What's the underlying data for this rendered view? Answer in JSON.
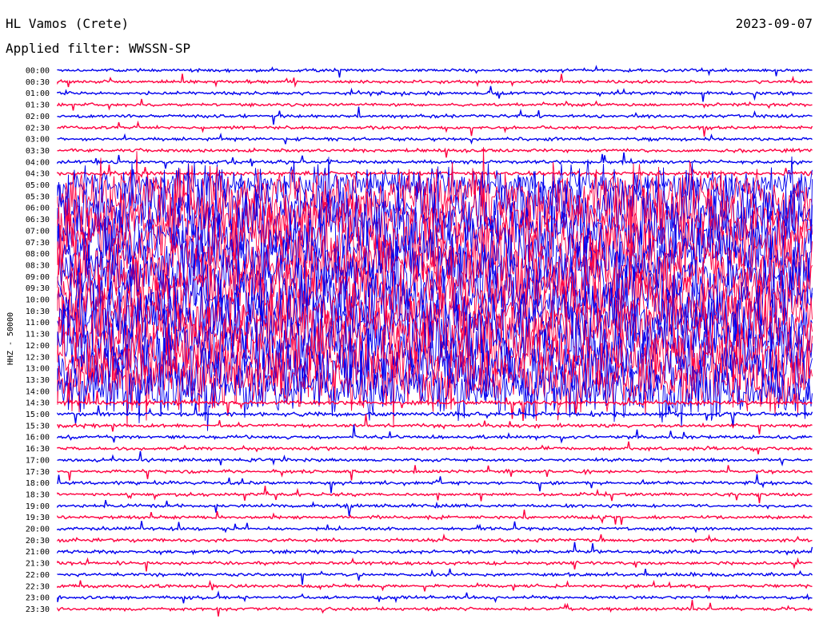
{
  "header": {
    "station": "HL Vamos (Crete)",
    "date": "2023-09-07",
    "filter": "Applied filter: WWSSN-SP"
  },
  "chart_data": {
    "type": "line",
    "ylabel": "HHZ - 50000",
    "colors": [
      "#0000ee",
      "#ff0040"
    ],
    "rows": [
      {
        "label": "00:00",
        "level": 0.12
      },
      {
        "label": "00:30",
        "level": 0.12
      },
      {
        "label": "01:00",
        "level": 0.12
      },
      {
        "label": "01:30",
        "level": 0.1
      },
      {
        "label": "02:00",
        "level": 0.12
      },
      {
        "label": "02:30",
        "level": 0.12
      },
      {
        "label": "03:00",
        "level": 0.14
      },
      {
        "label": "03:30",
        "level": 0.16
      },
      {
        "label": "04:00",
        "level": 0.22
      },
      {
        "label": "04:30",
        "level": 0.3
      },
      {
        "label": "05:00",
        "level": 0.55
      },
      {
        "label": "05:30",
        "level": 1.0
      },
      {
        "label": "06:00",
        "level": 1.0
      },
      {
        "label": "06:30",
        "level": 1.0
      },
      {
        "label": "07:00",
        "level": 1.0
      },
      {
        "label": "07:30",
        "level": 1.0
      },
      {
        "label": "08:00",
        "level": 1.0
      },
      {
        "label": "08:30",
        "level": 1.0
      },
      {
        "label": "09:00",
        "level": 1.0
      },
      {
        "label": "09:30",
        "level": 1.0
      },
      {
        "label": "10:00",
        "level": 1.0
      },
      {
        "label": "10:30",
        "level": 1.0
      },
      {
        "label": "11:00",
        "level": 1.0
      },
      {
        "label": "11:30",
        "level": 1.0
      },
      {
        "label": "12:00",
        "level": 1.0
      },
      {
        "label": "12:30",
        "level": 1.0
      },
      {
        "label": "13:00",
        "level": 1.0
      },
      {
        "label": "13:30",
        "level": 1.0
      },
      {
        "label": "14:00",
        "level": 0.85
      },
      {
        "label": "14:30",
        "level": 0.4
      },
      {
        "label": "15:00",
        "level": 0.35
      },
      {
        "label": "15:30",
        "level": 0.2
      },
      {
        "label": "16:00",
        "level": 0.18
      },
      {
        "label": "16:30",
        "level": 0.16
      },
      {
        "label": "17:00",
        "level": 0.15
      },
      {
        "label": "17:30",
        "level": 0.15
      },
      {
        "label": "18:00",
        "level": 0.15
      },
      {
        "label": "18:30",
        "level": 0.15
      },
      {
        "label": "19:00",
        "level": 0.15
      },
      {
        "label": "19:30",
        "level": 0.15
      },
      {
        "label": "20:00",
        "level": 0.15
      },
      {
        "label": "20:30",
        "level": 0.15
      },
      {
        "label": "21:00",
        "level": 0.14
      },
      {
        "label": "21:30",
        "level": 0.14
      },
      {
        "label": "22:00",
        "level": 0.14
      },
      {
        "label": "22:30",
        "level": 0.14
      },
      {
        "label": "23:00",
        "level": 0.13
      },
      {
        "label": "23:30",
        "level": 0.13
      }
    ]
  }
}
